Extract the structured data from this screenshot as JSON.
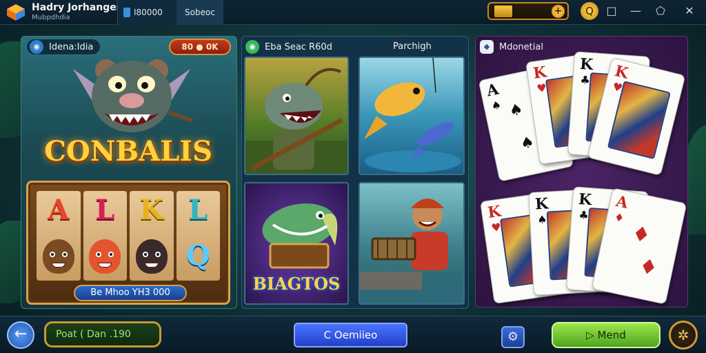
{
  "topbar": {
    "app_title": "Hadry Jorhanges",
    "app_subtitle": "Mubpdhdia",
    "coins_tab": "Ⅰ80000",
    "select_tab": "Sobeoc",
    "balance_plus": "+",
    "search_glyph": "Q",
    "window_controls": [
      "□",
      "—",
      "⬠",
      "✕"
    ]
  },
  "left_panel": {
    "header": "Idena:Idia",
    "header_icon": "◉",
    "jackpot": "80 ● 0K",
    "logo": "CONBALIS",
    "reels": [
      {
        "letter": "A",
        "color": "#e9442c",
        "symbol": "face",
        "face_color": "#7a4a22"
      },
      {
        "letter": "L",
        "color": "#d81f57",
        "symbol": "face",
        "face_color": "#e2552f"
      },
      {
        "letter": "K",
        "color": "#e8b21c",
        "symbol": "face",
        "face_color": "#3a2a2a"
      },
      {
        "letter": "L",
        "color": "#2fb6c4",
        "symbol": "q",
        "q_text": "Q"
      }
    ],
    "reel_bar": "Be Mhoo YH3 000"
  },
  "middle_panel": {
    "header": "Eba Seac R60d",
    "header_icon": "◉",
    "header_right": "Parchigh",
    "tiles": [
      {
        "id": "anglerfish-fisherman",
        "title": ""
      },
      {
        "id": "jumping-fish",
        "title": ""
      },
      {
        "id": "bass-game",
        "title": "BIAGTOS"
      },
      {
        "id": "river-fisherman",
        "title": ""
      }
    ]
  },
  "right_panel": {
    "header": "Mdonetial",
    "header_icon": "◆",
    "top_cards": [
      {
        "rank": "A",
        "suit": "♠",
        "color": "black"
      },
      {
        "rank": "K",
        "suit": "♥",
        "color": "red"
      },
      {
        "rank": "K",
        "suit": "♣",
        "color": "black"
      },
      {
        "rank": "K",
        "suit": "♥",
        "color": "red"
      }
    ],
    "bottom_cards": [
      {
        "rank": "K",
        "suit": "♥",
        "color": "red"
      },
      {
        "rank": "K",
        "suit": "♠",
        "color": "black"
      },
      {
        "rank": "K",
        "suit": "♣",
        "color": "black"
      },
      {
        "rank": "A",
        "suit": "♦",
        "color": "red"
      }
    ]
  },
  "bottombar": {
    "back_glyph": "←",
    "points_label": "Poat ( Dan .190",
    "center_button": "C Oemiieo",
    "gear_glyph": "⚙",
    "play_button": "▷ Mend",
    "menu_glyph": "✲"
  }
}
